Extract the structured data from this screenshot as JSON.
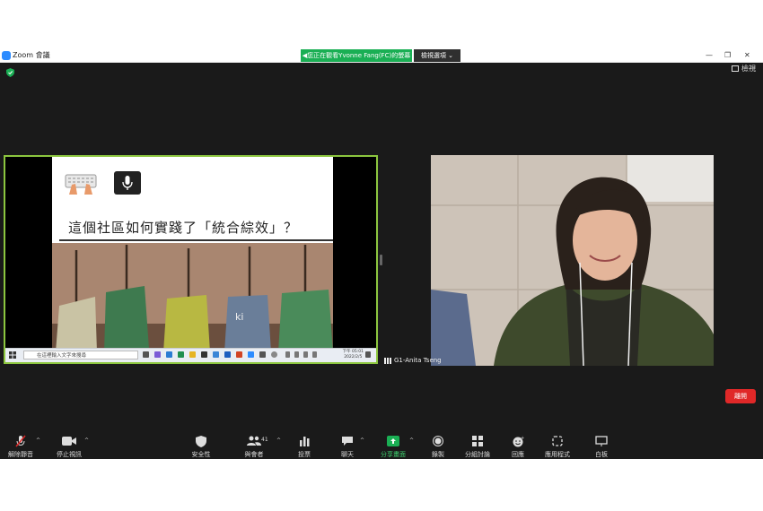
{
  "window": {
    "title": "Zoom 會議",
    "share_banner": "您正在觀看Yvonne  Fang(FC)的螢幕",
    "view_options": "檢視選項",
    "view_button": "檢視"
  },
  "shared_screen": {
    "slide_title": "這個社區如何實踐了「統合綜效」？",
    "taskbar_search_placeholder": "在這裡輸入文字來搜尋",
    "clock_time": "下午 05:01",
    "clock_date": "2022/2/5"
  },
  "participant": {
    "name": "G1-Anita Tseng"
  },
  "toolbar": {
    "unmute": "解除靜音",
    "stop_video": "停止視訊",
    "security": "安全性",
    "participants": "與會者",
    "participants_count": "41",
    "polls": "投票",
    "chat": "聊天",
    "share_screen": "分享畫面",
    "record": "錄製",
    "breakout": "分組討論",
    "reactions": "回應",
    "apps": "應用程式",
    "whiteboard": "白板",
    "leave": "離開"
  },
  "colors": {
    "share_banner": "#1aaf54",
    "active_speaker_border": "#8cc63f",
    "leave_button": "#e02828",
    "share_icon": "#1aaf54"
  }
}
